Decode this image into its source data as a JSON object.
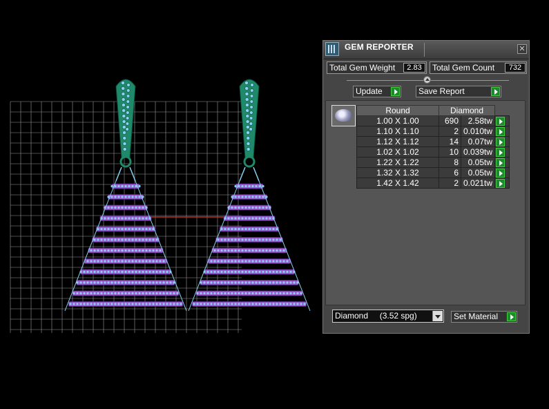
{
  "panel": {
    "title": "GEM REPORTER",
    "close_label": "✕",
    "total_weight_label": "Total Gem Weight",
    "total_weight_value": "2.83",
    "total_count_label": "Total Gem Count",
    "total_count_value": "732",
    "update_label": "Update",
    "save_label": "Save Report",
    "table": {
      "headers": [
        "Round",
        "Diamond"
      ],
      "rows": [
        {
          "size": "1.00 X 1.00",
          "count": "690",
          "weight": "2.58tw"
        },
        {
          "size": "1.10 X 1.10",
          "count": "2",
          "weight": "0.010tw"
        },
        {
          "size": "1.12 X 1.12",
          "count": "14",
          "weight": "0.07tw"
        },
        {
          "size": "1.02 X 1.02",
          "count": "10",
          "weight": "0.039tw"
        },
        {
          "size": "1.22 X 1.22",
          "count": "8",
          "weight": "0.05tw"
        },
        {
          "size": "1.32 X 1.32",
          "count": "6",
          "weight": "0.05tw"
        },
        {
          "size": "1.42 X 1.42",
          "count": "2",
          "weight": "0.021tw"
        }
      ]
    },
    "material_value": "Diamond     (3.52 spg)",
    "set_material_label": "Set Material"
  },
  "colors": {
    "grid": "#9a9a9a",
    "stone_green": "#1f8a6a",
    "stone_purple": "#9b59d0",
    "gem_blue": "#8ad0f0",
    "guide_red": "#c0392b",
    "go_green": "#1e8a2e"
  },
  "icons": [
    "gem-reporter-app-icon",
    "close-icon",
    "play-arrow-icon",
    "round-gem-icon",
    "chevron-down-icon"
  ]
}
